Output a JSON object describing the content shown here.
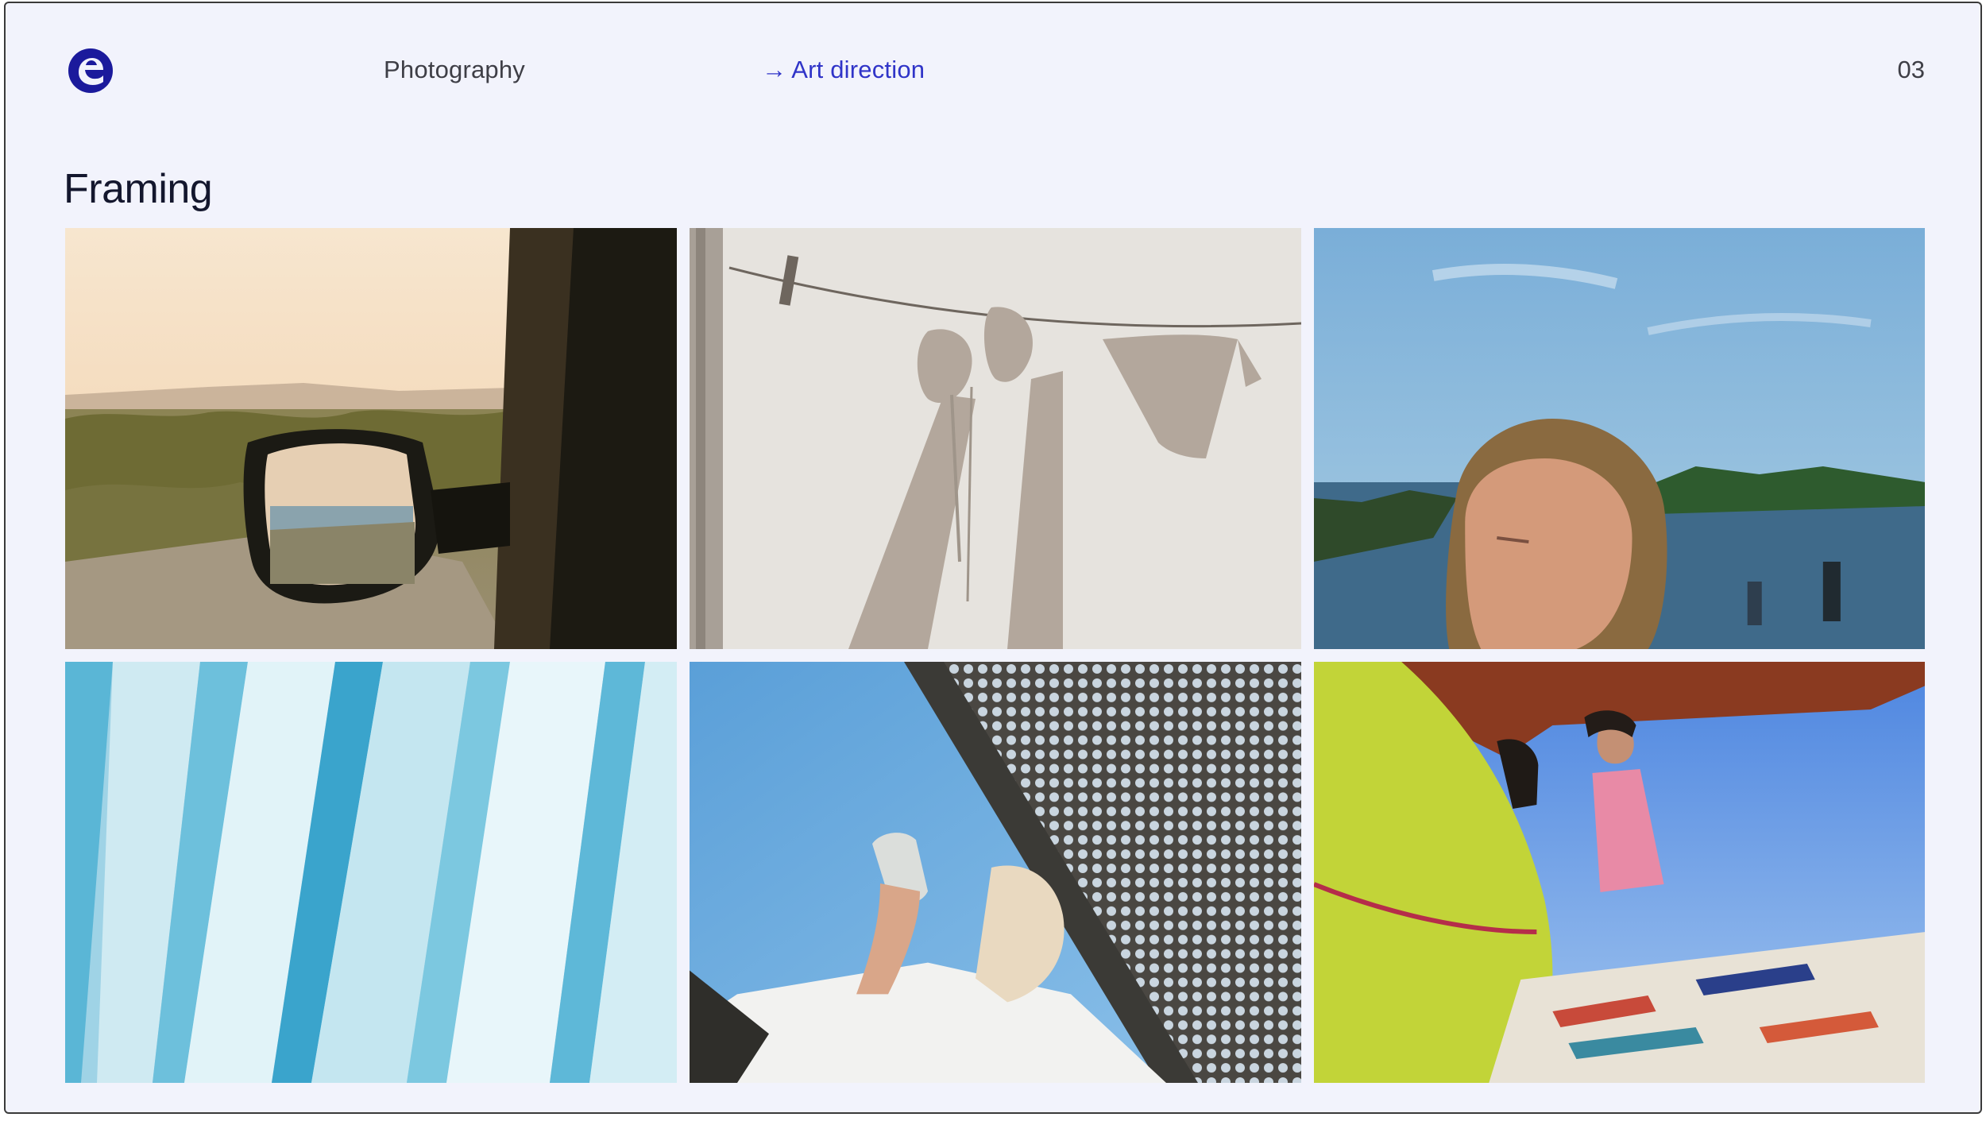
{
  "header": {
    "logo_icon": "brand-e-logo-icon",
    "section_label": "Photography",
    "link_arrow": "→",
    "link_label": "Art direction",
    "page_number": "03"
  },
  "main": {
    "title": "Framing"
  },
  "colors": {
    "background": "#f2f3fc",
    "accent": "#3034c8",
    "logo": "#1b1a9c",
    "text": "#14172e"
  },
  "gallery": [
    {
      "icon": "car-side-mirror-desert-photo"
    },
    {
      "icon": "clothesline-hands-shadow-photo"
    },
    {
      "icon": "woman-lake-portrait-photo"
    },
    {
      "icon": "blue-glacier-ice-photo"
    },
    {
      "icon": "raised-glass-sky-photo"
    },
    {
      "icon": "surfboard-woman-van-photo"
    }
  ]
}
